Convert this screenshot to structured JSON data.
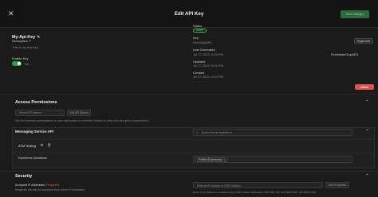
{
  "header": {
    "title": "Edit API Key",
    "close_icon": "close-icon",
    "save_label": "Save changes"
  },
  "key": {
    "name": "My-Api-Key",
    "description_label": "Description",
    "description_value": "This is my first key",
    "enable_label": "Enable Key",
    "toggle_text": "Yes",
    "status_label": "Status",
    "status_value": "Active",
    "key_label": "Key",
    "key_value": "SmYaQDuPu",
    "regenerate_label": "Regenerate",
    "last_generated_label": "Last Generated",
    "last_generated_value": "Jul 27 2023, 9:03 PM",
    "last_generated_by": "FirstNameGuy4921",
    "updated_label": "Updated",
    "updated_value": "Jul 27 2023, 9:03 PM",
    "created_label": "Created",
    "created_value": "Jul 27 2023, 9:03 PM",
    "delete_label": "Delete"
  },
  "access_permissions": {
    "title": "Access Permissions",
    "system_placeholder": "Select API System",
    "add_system_label": "Add API System",
    "hint": "Set the minimum permissions for your application to minimize impact in case your key gets compromised.",
    "service": {
      "title": "Messaging Service API",
      "search_placeholder": "Search for an experience",
      "item_name": "ATM Testing",
      "experience_label": "Experience Operations",
      "operation_chip": "Publish (Experience)"
    }
  },
  "security": {
    "title": "Security",
    "accepted_ip_label": "Accepted IP Addresses",
    "accepted_ip_required": "(Required)",
    "accepted_ip_hint": "Requests will only be accepted from these IP Addresses",
    "ip_placeholder": "Enter an IP address or CIDR notation",
    "add_ip_label": "Add IP Address",
    "ip_hint": "Enter an IP address or a subnet using CIDR notation (Examples: 2001:db8::/64, 192.168.0.0/32, 192.168.0.1/24)"
  }
}
